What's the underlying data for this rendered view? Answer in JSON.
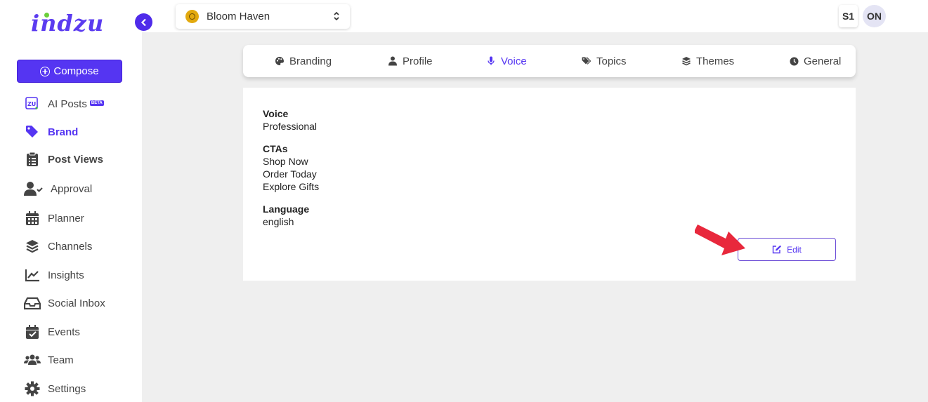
{
  "app": {
    "logo_text": "indzu"
  },
  "sidebar": {
    "compose_label": "Compose",
    "items": [
      {
        "key": "ai-posts",
        "label": "AI Posts",
        "badge": "BETA",
        "icon": "ai-posts-icon"
      },
      {
        "key": "brand",
        "label": "Brand",
        "icon": "tag-icon",
        "active": true
      },
      {
        "key": "post-views",
        "label": "Post Views",
        "icon": "clipboard-icon"
      },
      {
        "key": "approval",
        "label": "Approval",
        "icon": "user-check-icon"
      },
      {
        "key": "planner",
        "label": "Planner",
        "icon": "calendar-icon"
      },
      {
        "key": "channels",
        "label": "Channels",
        "icon": "layers-icon"
      },
      {
        "key": "insights",
        "label": "Insights",
        "icon": "chart-line-icon"
      },
      {
        "key": "social-inbox",
        "label": "Social Inbox",
        "icon": "inbox-icon"
      },
      {
        "key": "events",
        "label": "Events",
        "icon": "calendar-check-icon"
      },
      {
        "key": "team",
        "label": "Team",
        "icon": "users-icon"
      },
      {
        "key": "settings",
        "label": "Settings",
        "icon": "gear-icon"
      }
    ]
  },
  "header": {
    "brand_name": "Bloom Haven",
    "workspace_badge": "S1",
    "avatar_initials": "ON"
  },
  "tabs": [
    {
      "key": "branding",
      "label": "Branding",
      "icon": "palette-icon"
    },
    {
      "key": "profile",
      "label": "Profile",
      "icon": "user-icon"
    },
    {
      "key": "voice",
      "label": "Voice",
      "icon": "microphone-icon",
      "active": true
    },
    {
      "key": "topics",
      "label": "Topics",
      "icon": "tags-icon"
    },
    {
      "key": "themes",
      "label": "Themes",
      "icon": "layers-icon"
    },
    {
      "key": "general",
      "label": "General",
      "icon": "clock-icon"
    }
  ],
  "voice_panel": {
    "voice_label": "Voice",
    "voice_value": "Professional",
    "ctas_label": "CTAs",
    "ctas": [
      "Shop Now",
      "Order Today",
      "Explore Gifts"
    ],
    "language_label": "Language",
    "language_value": "english",
    "edit_label": "Edit"
  },
  "colors": {
    "accent": "#5535f2",
    "annotation_arrow": "#e8283c"
  }
}
